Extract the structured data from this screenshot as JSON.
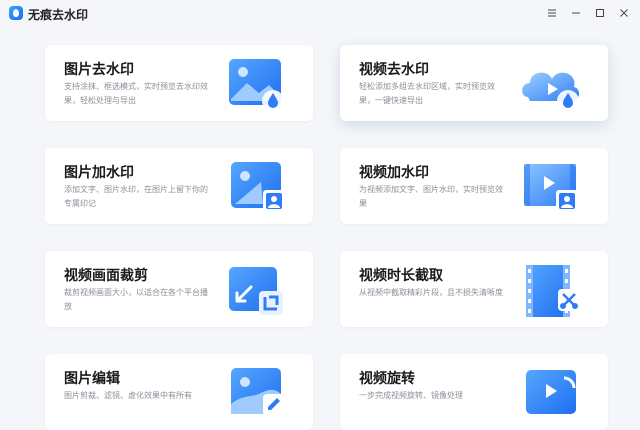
{
  "app": {
    "title": "无痕去水印"
  },
  "window": {
    "menu_icon": "menu-icon",
    "minimize_icon": "minimize-icon",
    "maximize_icon": "maximize-icon",
    "close_icon": "close-icon"
  },
  "cards": [
    {
      "title": "图片去水印",
      "desc": "支持涂抹、框选模式，实时预览去水印效果，轻松处理与导出",
      "icon": "image-remove-watermark-icon"
    },
    {
      "title": "视频去水印",
      "desc": "轻松添加多组去水印区域，实时预览效果，一键快速导出",
      "icon": "video-remove-watermark-icon"
    },
    {
      "title": "图片加水印",
      "desc": "添加文字、图片水印，在图片上留下你的专属印记",
      "icon": "image-add-watermark-icon"
    },
    {
      "title": "视频加水印",
      "desc": "为视频添加文字、图片水印，实时预览效果",
      "icon": "video-add-watermark-icon"
    },
    {
      "title": "视频画面裁剪",
      "desc": "裁剪视频画面大小，以适合在各个平台播放",
      "icon": "video-crop-icon"
    },
    {
      "title": "视频时长截取",
      "desc": "从视频中截取精彩片段，且不损失清晰度",
      "icon": "video-trim-icon"
    },
    {
      "title": "图片编辑",
      "desc": "图片剪裁、滤镜、虚化效果中有所有",
      "icon": "image-edit-icon"
    },
    {
      "title": "视频旋转",
      "desc": "一步完成视频旋转、镜像处理",
      "icon": "video-rotate-icon"
    }
  ],
  "colors": {
    "accent": "#2f7df6",
    "accent_light": "#7fb8ff",
    "background": "#f4f6f9"
  }
}
